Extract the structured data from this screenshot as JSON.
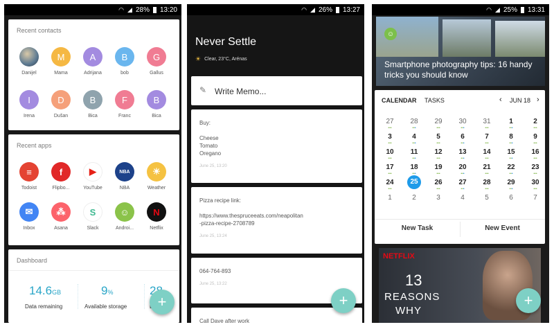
{
  "screens": [
    {
      "status": {
        "battery": "28%",
        "time": "13:20"
      },
      "recent_contacts": {
        "title": "Recent contacts",
        "contacts": [
          {
            "initial": "",
            "name": "Danijel",
            "color": "#6e8fa8"
          },
          {
            "initial": "M",
            "name": "Mama",
            "color": "#f5b843"
          },
          {
            "initial": "A",
            "name": "Adrijana",
            "color": "#a38be0"
          },
          {
            "initial": "B",
            "name": "bob",
            "color": "#6ab6ee"
          },
          {
            "initial": "G",
            "name": "Gallus",
            "color": "#f07c93"
          },
          {
            "initial": "I",
            "name": "Irena",
            "color": "#a38be0"
          },
          {
            "initial": "D",
            "name": "Dušan",
            "color": "#f5a07a"
          },
          {
            "initial": "B",
            "name": "Bica",
            "color": "#8fa3ad"
          },
          {
            "initial": "F",
            "name": "Franc",
            "color": "#f07c93"
          },
          {
            "initial": "B",
            "name": "Bica",
            "color": "#a38be0"
          }
        ]
      },
      "recent_apps": {
        "title": "Recent apps",
        "apps": [
          {
            "name": "Todoist",
            "icon": "todoist-icon",
            "color": "#e44332",
            "glyph": "≡"
          },
          {
            "name": "Flipbo...",
            "icon": "flipboard-icon",
            "color": "#e12828",
            "glyph": "f"
          },
          {
            "name": "YouTube",
            "icon": "youtube-icon",
            "color": "#ffffff",
            "glyph": "▶"
          },
          {
            "name": "NBA",
            "icon": "nba-icon",
            "color": "#1d428a",
            "glyph": "NBA"
          },
          {
            "name": "Weather",
            "icon": "weather-icon",
            "color": "#f5c242",
            "glyph": "☀"
          },
          {
            "name": "Inbox",
            "icon": "inbox-icon",
            "color": "#4285f4",
            "glyph": "✉"
          },
          {
            "name": "Asana",
            "icon": "asana-icon",
            "color": "#fc636b",
            "glyph": "⁂"
          },
          {
            "name": "Slack",
            "icon": "slack-icon",
            "color": "#ffffff",
            "glyph": "S"
          },
          {
            "name": "Androi...",
            "icon": "android-icon",
            "color": "#8bc34a",
            "glyph": "☺"
          },
          {
            "name": "Netflix",
            "icon": "netflix-icon",
            "color": "#111111",
            "glyph": "N"
          }
        ]
      },
      "dashboard": {
        "title": "Dashboard",
        "data_value": "14.6",
        "data_unit": "GB",
        "data_label": "Data remaining",
        "storage_value": "9",
        "storage_unit": "%",
        "storage_label": "Available storage",
        "third_value": "28",
        "third_label": "B"
      },
      "fab": "+"
    },
    {
      "status": {
        "battery": "26%",
        "time": "13:27"
      },
      "header": {
        "title": "Never Settle",
        "weather": "Clear, 23°C, Arénas"
      },
      "write_memo": "Write Memo...",
      "memos": [
        {
          "lines": [
            "Buy:",
            "",
            "Cheese",
            "Tomato",
            "Oregano"
          ],
          "date": "June 25, 13:20"
        },
        {
          "lines": [
            "Pizza recipe link:",
            "",
            "https://www.thespruceeats.com/neapolitan",
            "-pizza-recipe-2708789"
          ],
          "date": "June 25, 13:24"
        },
        {
          "lines": [
            "064-764-893"
          ],
          "date": "June 25, 13:22"
        },
        {
          "lines": [
            "Call Dave after work"
          ],
          "date": ""
        }
      ],
      "fab": "+"
    },
    {
      "status": {
        "battery": "25%",
        "time": "13:31"
      },
      "news": {
        "headline": "Smartphone photography tips: 16 handy tricks you should know"
      },
      "calendar": {
        "tab_calendar": "CALENDAR",
        "tab_tasks": "TASKS",
        "month": "JUN 18",
        "weeks": [
          [
            "27",
            "28",
            "29",
            "30",
            "31",
            "1",
            "2"
          ],
          [
            "3",
            "4",
            "5",
            "6",
            "7",
            "8",
            "9"
          ],
          [
            "10",
            "11",
            "12",
            "13",
            "14",
            "15",
            "16"
          ],
          [
            "17",
            "18",
            "19",
            "20",
            "21",
            "22",
            "23"
          ],
          [
            "24",
            "25",
            "26",
            "27",
            "28",
            "29",
            "30"
          ],
          [
            "1",
            "2",
            "3",
            "4",
            "5",
            "6",
            "7"
          ]
        ],
        "today": "25",
        "today_color": "#1e9be9",
        "new_task": "New Task",
        "new_event": "New Event"
      },
      "promo": {
        "brand": "NETFLIX",
        "number": "13",
        "line1": "REASONS",
        "line2": "WHY"
      },
      "fab": "+"
    }
  ]
}
